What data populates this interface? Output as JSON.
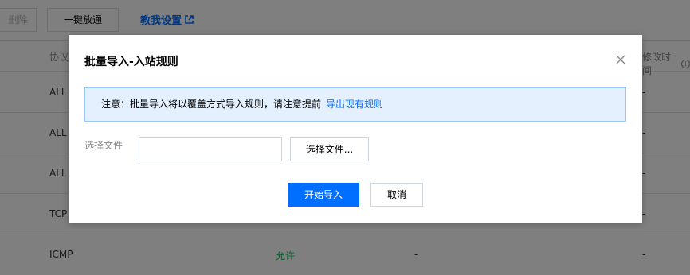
{
  "toolbar": {
    "delete_label": "删除",
    "release_all_label": "一键放通",
    "setup_link_label": "教我设置"
  },
  "table": {
    "headers": {
      "protocol": "协议",
      "modified": "修改时间"
    },
    "rows": [
      {
        "protocol": "ALL",
        "action": "",
        "dash": "",
        "modified": "-"
      },
      {
        "protocol": "ALL",
        "action": "",
        "dash": "",
        "modified": "-"
      },
      {
        "protocol": "ALL",
        "action": "",
        "dash": "",
        "modified": "-"
      },
      {
        "protocol": "TCP",
        "action": "",
        "dash": "",
        "modified": "-"
      },
      {
        "protocol": "ICMP",
        "action": "允许",
        "dash": "-",
        "modified": "-"
      }
    ]
  },
  "dialog": {
    "title": "批量导入-入站规则",
    "notice_text": "注意：批量导入将以覆盖方式导入规则，请注意提前",
    "notice_link": "导出现有规则",
    "file_label": "选择文件",
    "file_input_value": "",
    "choose_file_label": "选择文件...",
    "start_import_label": "开始导入",
    "cancel_label": "取消"
  },
  "colors": {
    "primary": "#006eff",
    "notice_bg": "#e5f0ff",
    "notice_border": "#97c7ff",
    "allow_green": "#0abf5b"
  }
}
